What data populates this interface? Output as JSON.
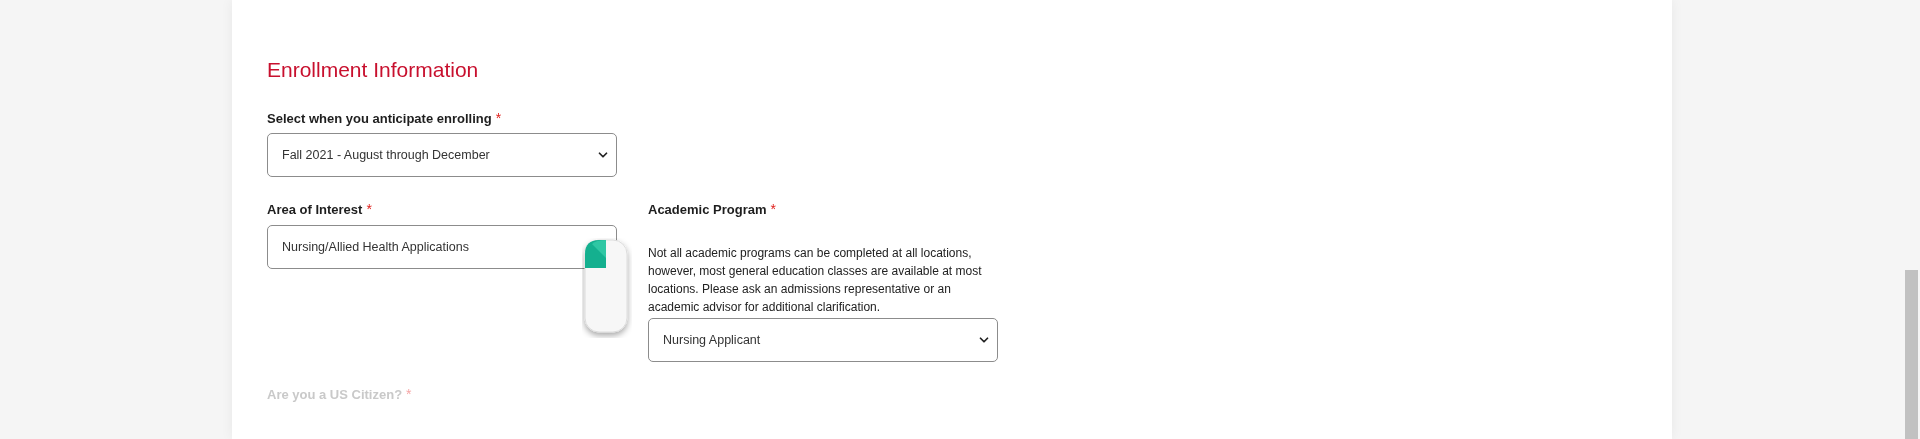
{
  "section": {
    "title": "Enrollment Information"
  },
  "enrollment": {
    "label": "Select when you anticipate enrolling",
    "required_mark": "*",
    "value": "Fall 2021 - August through December"
  },
  "area_of_interest": {
    "label": "Area of Interest",
    "required_mark": "*",
    "value": "Nursing/Allied Health Applications"
  },
  "academic_program": {
    "label": "Academic Program",
    "required_mark": "*",
    "note": "Not all academic programs can be completed at all locations, however, most general education classes are available at most locations. Please ask an admissions representative or an academic advisor for additional clarification.",
    "value": "Nursing Applicant"
  },
  "next_question": {
    "label": "Are you a US Citizen?",
    "required_mark": "*"
  }
}
